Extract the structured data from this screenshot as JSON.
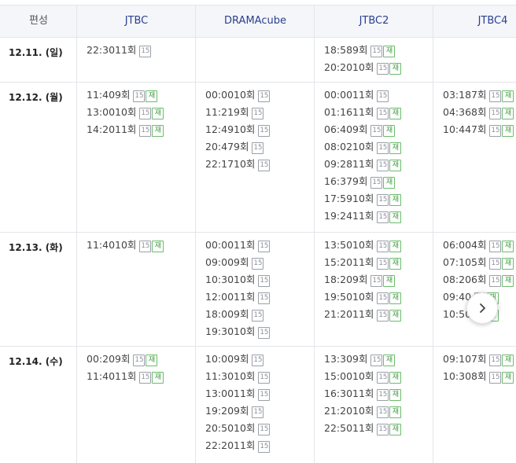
{
  "header": {
    "label": "편성",
    "channels": [
      "JTBC",
      "DRAMAcube",
      "JTBC2",
      "JTBC4"
    ]
  },
  "badge_rating": "15",
  "badge_rerun": "재",
  "next_icon": "chevron-right-icon",
  "rows": [
    {
      "date": "12.11. (일)",
      "channels": [
        [
          {
            "time": "22:30",
            "ep": "11회",
            "rerun": false
          }
        ],
        [],
        [
          {
            "time": "18:58",
            "ep": "9회",
            "rerun": true
          },
          {
            "time": "20:20",
            "ep": "10회",
            "rerun": true
          }
        ],
        []
      ]
    },
    {
      "date": "12.12. (월)",
      "channels": [
        [
          {
            "time": "11:40",
            "ep": "9회",
            "rerun": true
          },
          {
            "time": "13:00",
            "ep": "10회",
            "rerun": true
          },
          {
            "time": "14:20",
            "ep": "11회",
            "rerun": true
          }
        ],
        [
          {
            "time": "00:00",
            "ep": "10회",
            "rerun": false
          },
          {
            "time": "11:21",
            "ep": "9회",
            "rerun": false
          },
          {
            "time": "12:49",
            "ep": "10회",
            "rerun": false
          },
          {
            "time": "20:47",
            "ep": "9회",
            "rerun": false
          },
          {
            "time": "22:17",
            "ep": "10회",
            "rerun": false
          }
        ],
        [
          {
            "time": "00:00",
            "ep": "11회",
            "rerun": false
          },
          {
            "time": "01:16",
            "ep": "11회",
            "rerun": true
          },
          {
            "time": "06:40",
            "ep": "9회",
            "rerun": true
          },
          {
            "time": "08:02",
            "ep": "10회",
            "rerun": true
          },
          {
            "time": "09:28",
            "ep": "11회",
            "rerun": true
          },
          {
            "time": "16:37",
            "ep": "9회",
            "rerun": true
          },
          {
            "time": "17:59",
            "ep": "10회",
            "rerun": true
          },
          {
            "time": "19:24",
            "ep": "11회",
            "rerun": true
          }
        ],
        [
          {
            "time": "03:18",
            "ep": "7회",
            "rerun": true
          },
          {
            "time": "04:36",
            "ep": "8회",
            "rerun": true
          },
          {
            "time": "10:44",
            "ep": "7회",
            "rerun": true
          }
        ]
      ]
    },
    {
      "date": "12.13. (화)",
      "channels": [
        [
          {
            "time": "11:40",
            "ep": "10회",
            "rerun": true
          }
        ],
        [
          {
            "time": "00:00",
            "ep": "11회",
            "rerun": false
          },
          {
            "time": "09:00",
            "ep": "9회",
            "rerun": false
          },
          {
            "time": "10:30",
            "ep": "10회",
            "rerun": false
          },
          {
            "time": "12:00",
            "ep": "11회",
            "rerun": false
          },
          {
            "time": "18:00",
            "ep": "9회",
            "rerun": false
          },
          {
            "time": "19:30",
            "ep": "10회",
            "rerun": false
          }
        ],
        [
          {
            "time": "13:50",
            "ep": "10회",
            "rerun": true
          },
          {
            "time": "15:20",
            "ep": "11회",
            "rerun": true
          },
          {
            "time": "18:20",
            "ep": "9회",
            "rerun": true
          },
          {
            "time": "19:50",
            "ep": "10회",
            "rerun": true
          },
          {
            "time": "21:20",
            "ep": "11회",
            "rerun": true
          }
        ],
        [
          {
            "time": "06:00",
            "ep": "4회",
            "rerun": true
          },
          {
            "time": "07:10",
            "ep": "5회",
            "rerun": true
          },
          {
            "time": "08:20",
            "ep": "6회",
            "rerun": true
          },
          {
            "time": "09:40",
            "ep": "",
            "rerun": true
          },
          {
            "time": "10:50",
            "ep": "",
            "rerun": true
          }
        ]
      ]
    },
    {
      "date": "12.14. (수)",
      "channels": [
        [
          {
            "time": "00:20",
            "ep": "9회",
            "rerun": true
          },
          {
            "time": "11:40",
            "ep": "11회",
            "rerun": true
          }
        ],
        [
          {
            "time": "10:00",
            "ep": "9회",
            "rerun": false
          },
          {
            "time": "11:30",
            "ep": "10회",
            "rerun": false
          },
          {
            "time": "13:00",
            "ep": "11회",
            "rerun": false
          },
          {
            "time": "19:20",
            "ep": "9회",
            "rerun": false
          },
          {
            "time": "20:50",
            "ep": "10회",
            "rerun": false
          },
          {
            "time": "22:20",
            "ep": "11회",
            "rerun": false
          }
        ],
        [
          {
            "time": "13:30",
            "ep": "9회",
            "rerun": true
          },
          {
            "time": "15:00",
            "ep": "10회",
            "rerun": true
          },
          {
            "time": "16:30",
            "ep": "11회",
            "rerun": true
          },
          {
            "time": "21:20",
            "ep": "10회",
            "rerun": true
          },
          {
            "time": "22:50",
            "ep": "11회",
            "rerun": true
          }
        ],
        [
          {
            "time": "09:10",
            "ep": "7회",
            "rerun": true
          },
          {
            "time": "10:30",
            "ep": "8회",
            "rerun": true
          }
        ]
      ]
    }
  ]
}
